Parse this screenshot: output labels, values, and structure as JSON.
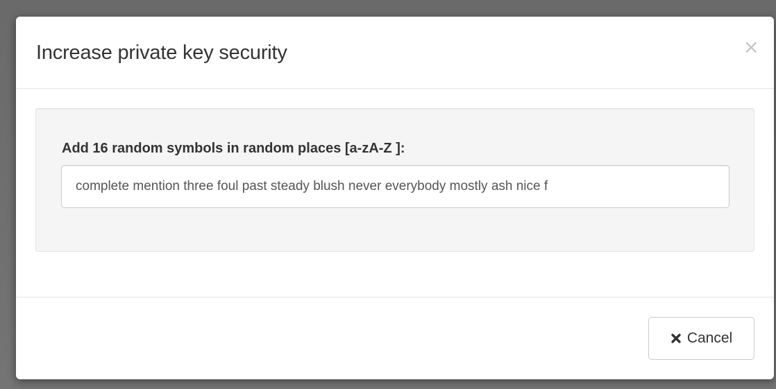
{
  "dialog": {
    "title": "Increase private key security",
    "close_glyph": "×"
  },
  "form": {
    "label": "Add 16 random symbols in random places [a-zA-Z ]:",
    "input_value": "complete mention three foul past steady blush never everybody mostly ash nice f"
  },
  "footer": {
    "cancel_label": "Cancel",
    "cancel_icon": "times-icon"
  }
}
